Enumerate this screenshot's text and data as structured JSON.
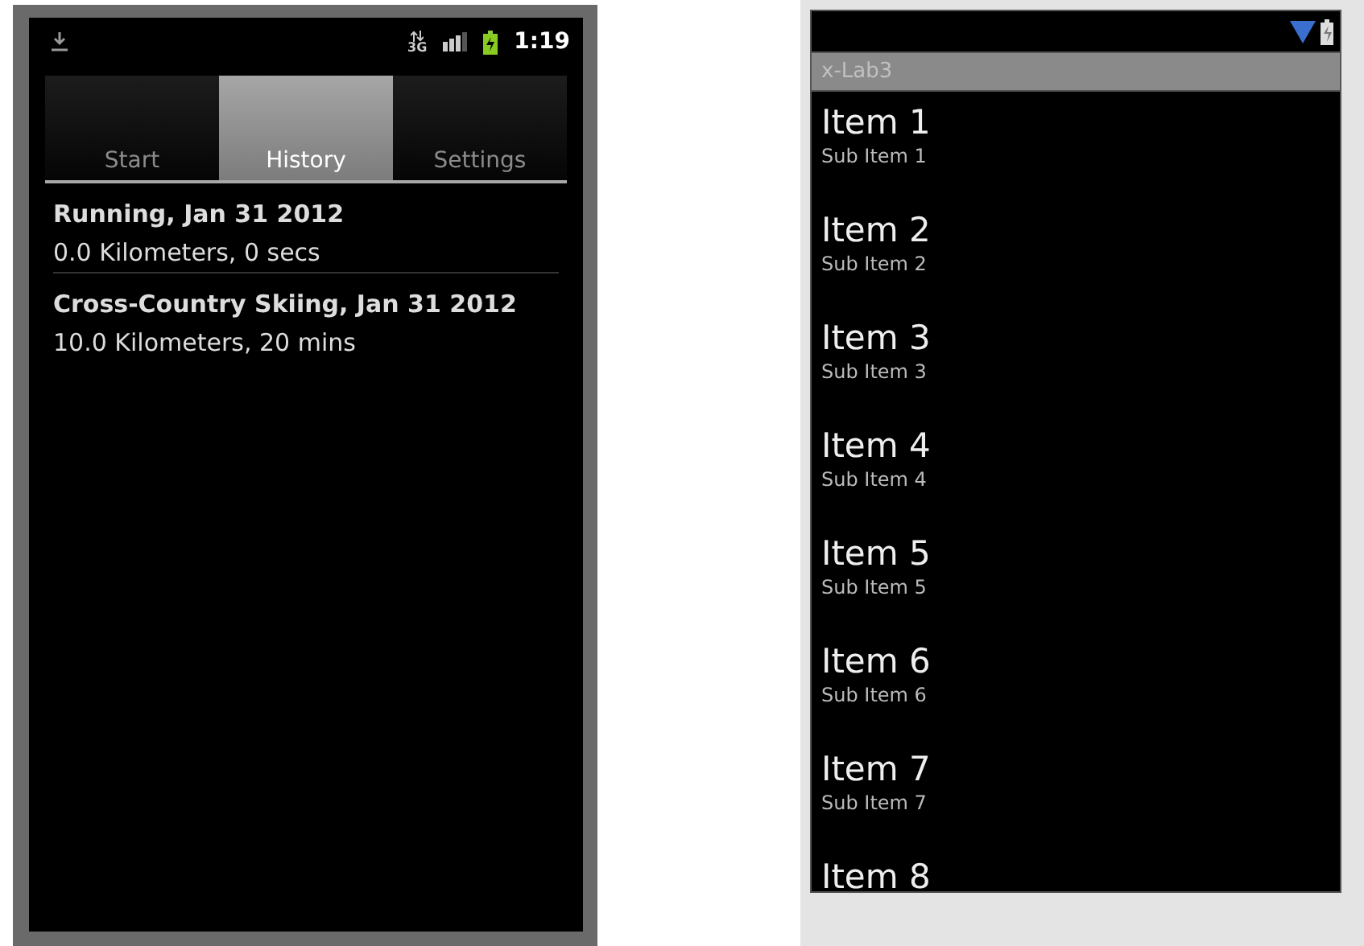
{
  "left_phone": {
    "status_bar": {
      "network": "3G",
      "time": "1:19"
    },
    "tabs": [
      {
        "label": "Start",
        "selected": false
      },
      {
        "label": "History",
        "selected": true
      },
      {
        "label": "Settings",
        "selected": false
      }
    ],
    "history": [
      {
        "title": "Running, Jan 31 2012",
        "detail": "0.0 Kilometers, 0 secs"
      },
      {
        "title": "Cross-Country Skiing, Jan 31 2012",
        "detail": "10.0 Kilometers, 20 mins"
      }
    ]
  },
  "right_phone": {
    "title": "x-Lab3",
    "items": [
      {
        "title": "Item 1",
        "subtitle": "Sub Item 1"
      },
      {
        "title": "Item 2",
        "subtitle": "Sub Item 2"
      },
      {
        "title": "Item 3",
        "subtitle": "Sub Item 3"
      },
      {
        "title": "Item 4",
        "subtitle": "Sub Item 4"
      },
      {
        "title": "Item 5",
        "subtitle": "Sub Item 5"
      },
      {
        "title": "Item 6",
        "subtitle": "Sub Item 6"
      },
      {
        "title": "Item 7",
        "subtitle": "Sub Item 7"
      },
      {
        "title": "Item 8"
      }
    ]
  }
}
